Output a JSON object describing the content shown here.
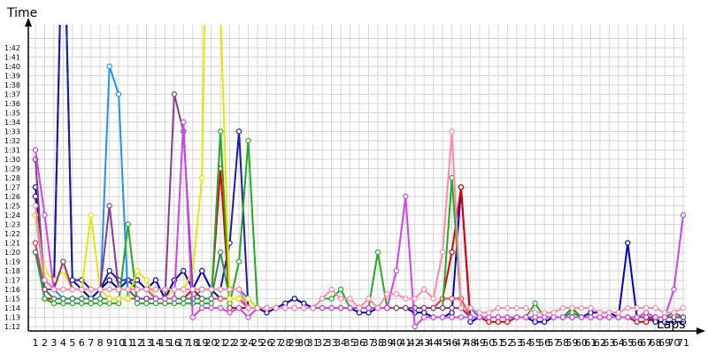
{
  "chart_data": {
    "type": "line",
    "ylabel": "Time",
    "xlabel": "Laps",
    "grid": true,
    "xlim": [
      1,
      71
    ],
    "ylim": [
      71,
      103
    ],
    "y_ticks": [
      {
        "v": 72,
        "label": "1:12"
      },
      {
        "v": 73,
        "label": "1:13"
      },
      {
        "v": 74,
        "label": "1:14"
      },
      {
        "v": 75,
        "label": "1:15"
      },
      {
        "v": 76,
        "label": "1:16"
      },
      {
        "v": 77,
        "label": "1:17"
      },
      {
        "v": 78,
        "label": "1:18"
      },
      {
        "v": 79,
        "label": "1:19"
      },
      {
        "v": 80,
        "label": "1:20"
      },
      {
        "v": 81,
        "label": "1:21"
      },
      {
        "v": 82,
        "label": "1:22"
      },
      {
        "v": 83,
        "label": "1:23"
      },
      {
        "v": 84,
        "label": "1:24"
      },
      {
        "v": 85,
        "label": "1:25"
      },
      {
        "v": 86,
        "label": "1:26"
      },
      {
        "v": 87,
        "label": "1:27"
      },
      {
        "v": 88,
        "label": "1:28"
      },
      {
        "v": 89,
        "label": "1:29"
      },
      {
        "v": 90,
        "label": "1:30"
      },
      {
        "v": 91,
        "label": "1:31"
      },
      {
        "v": 92,
        "label": "1:32"
      },
      {
        "v": 93,
        "label": "1:33"
      },
      {
        "v": 94,
        "label": "1:34"
      },
      {
        "v": 95,
        "label": "1:35"
      },
      {
        "v": 96,
        "label": "1:36"
      },
      {
        "v": 97,
        "label": "1:37"
      },
      {
        "v": 98,
        "label": "1:38"
      },
      {
        "v": 99,
        "label": "1:39"
      },
      {
        "v": 100,
        "label": "1:40"
      },
      {
        "v": 101,
        "label": "1:41"
      },
      {
        "v": 102,
        "label": "1:42"
      }
    ],
    "x_ticks": [
      "1",
      "2",
      "3",
      "4",
      "5",
      "6",
      "7",
      "8",
      "9",
      "10",
      "11",
      "12",
      "13",
      "14",
      "15",
      "16",
      "17",
      "18",
      "19",
      "20",
      "21",
      "22",
      "23",
      "24",
      "25",
      "26",
      "27",
      "28",
      "29",
      "30",
      "31",
      "32",
      "33",
      "34",
      "35",
      "36",
      "37",
      "38",
      "39",
      "40",
      "41",
      "42",
      "43",
      "44",
      "45",
      "46",
      "47",
      "48",
      "49",
      "50",
      "51",
      "52",
      "53",
      "54",
      "55",
      "56",
      "57",
      "58",
      "59",
      "60",
      "61",
      "62",
      "63",
      "64",
      "65",
      "66",
      "67",
      "68",
      "69",
      "70",
      "71"
    ],
    "series": [
      {
        "color": "#0000cc",
        "values": [
          87,
          77,
          76,
          120,
          77,
          76,
          75,
          76,
          77,
          76,
          77,
          77,
          76,
          77,
          75,
          77,
          78,
          76,
          78,
          76,
          75,
          75,
          75,
          74,
          74,
          73.5,
          74,
          74.5,
          75,
          74.5,
          74,
          74,
          74,
          74,
          74,
          73.5,
          73.5,
          74,
          74,
          74,
          74,
          73.5,
          73.5,
          73,
          73,
          73.5,
          87,
          72.5,
          73,
          73,
          73,
          73,
          73,
          73,
          72.5,
          72.5,
          73,
          73,
          73,
          73,
          73.5,
          73.5,
          73.5,
          73,
          81,
          73,
          73,
          72.5,
          72.5,
          72.5,
          72.5
        ]
      },
      {
        "color": "#1a1ab0",
        "values": [
          86,
          77,
          76,
          120,
          77,
          77,
          76,
          76,
          78,
          77,
          77,
          76,
          76,
          76,
          76,
          76,
          76,
          76,
          76,
          76,
          76,
          81,
          93,
          74,
          74,
          74,
          74,
          74,
          74,
          74,
          74,
          74,
          74,
          74,
          74,
          74,
          74,
          74,
          74,
          74,
          74,
          74,
          74,
          74,
          74,
          74,
          74,
          74,
          73,
          73,
          73,
          73,
          73,
          73,
          73,
          73,
          73,
          73,
          73,
          73,
          73,
          73,
          73,
          73,
          73,
          73,
          73,
          73,
          73,
          73,
          73
        ]
      },
      {
        "color": "#1e90ff",
        "values": [
          84,
          77,
          76,
          75,
          75,
          75,
          75,
          75,
          100,
          97,
          75,
          75,
          75,
          75,
          75,
          75,
          75,
          75,
          76,
          76,
          76,
          76,
          76,
          75,
          74,
          74,
          74,
          74,
          74,
          74,
          74,
          74,
          74,
          74,
          74,
          74,
          74,
          74,
          74,
          74,
          74,
          74,
          74,
          74,
          74,
          74,
          74,
          74,
          73,
          73,
          73,
          73,
          73,
          73,
          73,
          73,
          73,
          73,
          73,
          73,
          73,
          73,
          73,
          73,
          73,
          73,
          73,
          73,
          73,
          73,
          73
        ]
      },
      {
        "color": "#e60000",
        "values": [
          81,
          75,
          75,
          75,
          75,
          75,
          75,
          75,
          75,
          75,
          75,
          75,
          75,
          75,
          75,
          75,
          75,
          76,
          75,
          75,
          89,
          74,
          74,
          74,
          74,
          74,
          74,
          74,
          74,
          74,
          74,
          74,
          74,
          74,
          74,
          74,
          74,
          74,
          74,
          74,
          74,
          74,
          74,
          74,
          75,
          80,
          87,
          73,
          73,
          72.5,
          72.5,
          72.5,
          73,
          73,
          73,
          73,
          73,
          73,
          73,
          73,
          73,
          73,
          73,
          73,
          73,
          72.5,
          72.5,
          73,
          73,
          73,
          73
        ]
      },
      {
        "color": "#ff4040",
        "values": [
          81,
          76,
          75,
          75,
          75,
          75,
          75,
          75,
          75,
          75,
          75,
          75,
          75,
          75,
          75,
          75,
          75,
          75,
          75,
          75,
          75,
          75,
          75,
          74,
          74,
          74,
          74,
          74,
          74,
          74,
          74,
          74,
          74,
          74,
          74,
          74,
          74,
          74,
          74,
          74,
          74,
          74,
          74,
          74,
          75,
          75,
          75,
          73,
          73,
          73,
          73,
          73,
          73,
          73,
          73,
          73,
          73,
          73,
          73,
          73,
          73,
          73,
          73,
          73,
          73,
          73,
          73,
          73,
          73,
          73,
          73
        ]
      },
      {
        "color": "#22aa22",
        "values": [
          80,
          75,
          74.5,
          74.5,
          74.5,
          74.5,
          74.5,
          74.5,
          74.5,
          74.5,
          83,
          74.5,
          74.5,
          74.5,
          74.5,
          74.5,
          74.5,
          74.5,
          74.5,
          74.5,
          93,
          74.5,
          79,
          92,
          74,
          74,
          74,
          74,
          74,
          74,
          74,
          75,
          75,
          76,
          74,
          74,
          74,
          80,
          74,
          74,
          74,
          74,
          74,
          74,
          74,
          88,
          74,
          73,
          73,
          73,
          73,
          73,
          73,
          73,
          74.5,
          73,
          73,
          73,
          73.5,
          73,
          73,
          73,
          73,
          73,
          73,
          73,
          73,
          73,
          73,
          73,
          73
        ]
      },
      {
        "color": "#2e8b57",
        "values": [
          80,
          76,
          75,
          75,
          75,
          75,
          75,
          75,
          75,
          75,
          75,
          75,
          75,
          75,
          75,
          75,
          75,
          75,
          75,
          75,
          80,
          75,
          75,
          75,
          74,
          74,
          74,
          74,
          74,
          74,
          74,
          74,
          74,
          74,
          74,
          74,
          74,
          74,
          74,
          74,
          74,
          74,
          74,
          74,
          74,
          74,
          74,
          73,
          73,
          73,
          73,
          73,
          73,
          73,
          73,
          73,
          73,
          73,
          74,
          73,
          73,
          73,
          73,
          73,
          73,
          73,
          73,
          73,
          73,
          73.5,
          73
        ]
      },
      {
        "color": "#e6e600",
        "values": [
          84,
          78,
          77,
          78,
          76,
          76,
          84,
          76,
          75,
          75,
          75,
          78,
          77,
          75,
          75,
          76,
          76,
          78,
          88,
          150,
          106,
          75,
          75,
          75,
          74,
          74,
          74,
          74,
          74,
          74,
          74,
          74,
          74,
          74,
          74,
          74,
          74,
          74,
          74,
          74,
          74,
          74,
          74,
          74,
          74,
          74,
          74,
          73,
          73,
          73,
          73,
          73,
          73,
          73,
          73,
          73,
          73,
          73,
          73,
          73,
          73,
          73,
          73,
          73,
          73,
          73,
          73,
          73,
          73,
          73,
          73
        ]
      },
      {
        "color": "#8b3a8b",
        "values": [
          90,
          76,
          76,
          79,
          76,
          76,
          76,
          76,
          85,
          76,
          76,
          75,
          75,
          75,
          75,
          97,
          93,
          76,
          76,
          76,
          76,
          76,
          76,
          74,
          74,
          74,
          74,
          74,
          74,
          74,
          74,
          74,
          74,
          74,
          74,
          74,
          74,
          74,
          74,
          74,
          74,
          74,
          74,
          74,
          74,
          74,
          74,
          73,
          73,
          73,
          73,
          73,
          73,
          73,
          73,
          73,
          73,
          73,
          73,
          73,
          73,
          73,
          73,
          73,
          73,
          73,
          73,
          73,
          73,
          73,
          73
        ]
      },
      {
        "color": "#cc44ee",
        "values": [
          91,
          84,
          76,
          76,
          76,
          76,
          76,
          76,
          76,
          76,
          76,
          76,
          76,
          75,
          75,
          75,
          94,
          73,
          74,
          74,
          74,
          73.5,
          74,
          73,
          74,
          74,
          74,
          74,
          74,
          74,
          74,
          74,
          74,
          74,
          74,
          74,
          74,
          74,
          74,
          78,
          86,
          72,
          73,
          73,
          73,
          73,
          73,
          73,
          73,
          73,
          73,
          73,
          73,
          73,
          73,
          73,
          73,
          73,
          73,
          73,
          73,
          73,
          73,
          73,
          73,
          73,
          73.5,
          73,
          73,
          76,
          84
        ]
      },
      {
        "color": "#ff88aa",
        "values": [
          85,
          77,
          76,
          76,
          76,
          76,
          76,
          76,
          76,
          76,
          76,
          76,
          76,
          76,
          76,
          76,
          76,
          76,
          76,
          76,
          76,
          76,
          76,
          74,
          74,
          74,
          74,
          74,
          74,
          74,
          74,
          75,
          76,
          75,
          75,
          74,
          75,
          74,
          75.5,
          75.5,
          75,
          75,
          76,
          75,
          80,
          93,
          74,
          74,
          73.5,
          73.5,
          74,
          74,
          74,
          74,
          73.5,
          73.5,
          73.5,
          74,
          74,
          74,
          74,
          73.5,
          73.5,
          73.5,
          74,
          74,
          74,
          74,
          73.5,
          73.5,
          74
        ]
      }
    ]
  }
}
